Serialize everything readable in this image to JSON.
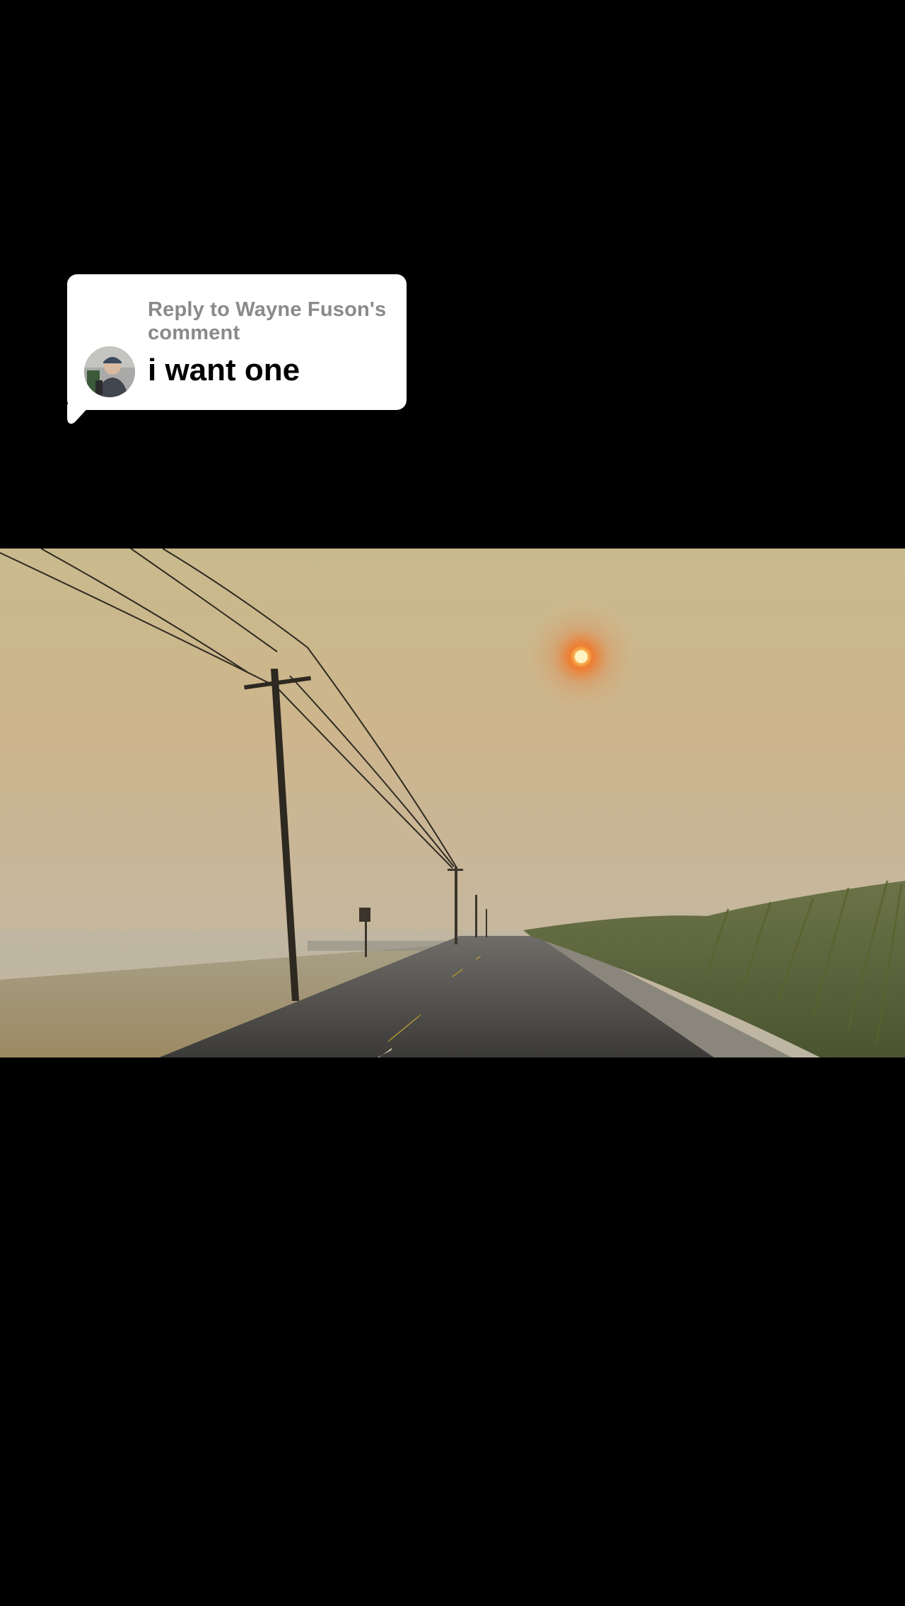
{
  "reply": {
    "header": "Reply to Wayne Fuson's comment",
    "text": "i want one"
  },
  "video": {
    "scene": "smoky-sky-road"
  },
  "colors": {
    "background": "#000000",
    "bubble": "#ffffff",
    "header_text": "#8a8a8a",
    "body_text": "#000000",
    "sky_top": "#c8b98c",
    "sky_haze": "#c9b691",
    "sun": "#ff9a3c"
  }
}
